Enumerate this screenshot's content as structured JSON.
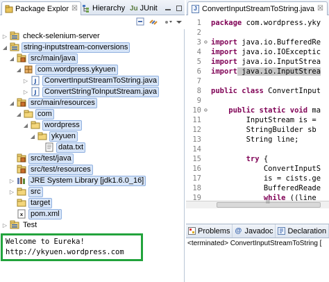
{
  "left_pane": {
    "tabs": [
      {
        "label": "Package Explor",
        "close": "☒"
      },
      {
        "label": "Hierarchy"
      },
      {
        "label": "JUnit"
      }
    ],
    "tree": [
      {
        "label": "check-selenium-server",
        "icon": "project-icon",
        "level": 0,
        "expanded": false
      },
      {
        "label": "string-inputstream-conversions",
        "icon": "project-icon",
        "level": 0,
        "expanded": true,
        "selected": true
      },
      {
        "label": "src/main/java",
        "icon": "source-folder-icon",
        "level": 1,
        "expanded": true,
        "selected": true
      },
      {
        "label": "com.wordpress.ykyuen",
        "icon": "package-icon",
        "level": 2,
        "expanded": true,
        "selected": true
      },
      {
        "label": "ConvertInputStreamToString.java",
        "icon": "java-file-icon",
        "level": 3,
        "expanded": false,
        "selected": true
      },
      {
        "label": "ConvertStringToInputStream.java",
        "icon": "java-file-icon",
        "level": 3,
        "expanded": false,
        "selected": true
      },
      {
        "label": "src/main/resources",
        "icon": "source-folder-icon",
        "level": 1,
        "expanded": true,
        "selected": true
      },
      {
        "label": "com",
        "icon": "folder-icon",
        "level": 2,
        "expanded": true,
        "selected": true
      },
      {
        "label": "wordpress",
        "icon": "folder-icon",
        "level": 3,
        "expanded": true,
        "selected": true
      },
      {
        "label": "ykyuen",
        "icon": "folder-icon",
        "level": 4,
        "expanded": true,
        "selected": true
      },
      {
        "label": "data.txt",
        "icon": "text-file-icon",
        "level": 5,
        "expanded": null,
        "selected": true
      },
      {
        "label": "src/test/java",
        "icon": "source-folder-icon",
        "level": 1,
        "expanded": null,
        "selected": true
      },
      {
        "label": "src/test/resources",
        "icon": "source-folder-icon",
        "level": 1,
        "expanded": null,
        "selected": true
      },
      {
        "label": "JRE System Library [jdk1.6.0_16]",
        "icon": "library-icon",
        "level": 1,
        "expanded": false,
        "selected": true
      },
      {
        "label": "src",
        "icon": "folder-icon",
        "level": 1,
        "expanded": false,
        "selected": true
      },
      {
        "label": "target",
        "icon": "folder-icon",
        "level": 1,
        "expanded": null,
        "selected": true
      },
      {
        "label": "pom.xml",
        "icon": "xml-file-icon",
        "level": 1,
        "expanded": null,
        "selected": true
      },
      {
        "label": "Test",
        "icon": "project-icon",
        "level": 0,
        "expanded": false
      }
    ]
  },
  "editor": {
    "tab_label": "ConvertInputStreamToString.java",
    "tab_close": "☒",
    "lines": [
      {
        "n": "1",
        "kw": "package",
        "rest": " com.wordpress.yky"
      },
      {
        "n": "2",
        "kw": "",
        "rest": ""
      },
      {
        "n": "3",
        "fold": "⊖",
        "kw": "import",
        "rest": " java.io.BufferedRe"
      },
      {
        "n": "4",
        "kw": "import",
        "rest": " java.io.IOExceptic"
      },
      {
        "n": "5",
        "kw": "import",
        "rest": " java.io.InputStrea"
      },
      {
        "n": "6",
        "kw": "import",
        "rest": " java.io.InputStrea",
        "highlight": true
      },
      {
        "n": "7",
        "kw": "",
        "rest": ""
      },
      {
        "n": "8",
        "kw": "public class",
        "rest": " ConvertInput"
      },
      {
        "n": "9",
        "kw": "",
        "rest": ""
      },
      {
        "n": "10",
        "fold": "⊖",
        "kw": "    public static void",
        "rest": " ma"
      },
      {
        "n": "11",
        "kw": "",
        "rest": "        InputStream is ="
      },
      {
        "n": "12",
        "kw": "",
        "rest": "        StringBuilder sb"
      },
      {
        "n": "13",
        "kw": "",
        "rest": "        String line;"
      },
      {
        "n": "14",
        "kw": "",
        "rest": ""
      },
      {
        "n": "15",
        "kw": "        try",
        "rest": " {"
      },
      {
        "n": "16",
        "kw": "",
        "rest": "            ConvertInputS"
      },
      {
        "n": "17",
        "kw": "",
        "rest": "            is = cists.ge"
      },
      {
        "n": "18",
        "kw": "",
        "rest": "            BufferedReade"
      },
      {
        "n": "19",
        "kw": "            while",
        "rest": " ((line"
      }
    ],
    "scroll_label": "III"
  },
  "console": {
    "tabs": [
      {
        "label": "Problems",
        "icon": "problems-icon"
      },
      {
        "label": "Javadoc",
        "icon": "javadoc-icon"
      },
      {
        "label": "Declaration",
        "icon": "declaration-icon"
      }
    ],
    "terminated": "<terminated> ConvertInputStreamToString [",
    "output": [
      "Welcome to Eureka!",
      "http://ykyuen.wordpress.com"
    ]
  },
  "colors": {
    "keyword": "#7f0055",
    "highlight_border": "#22a33c",
    "selection": "#d6e4f7"
  }
}
